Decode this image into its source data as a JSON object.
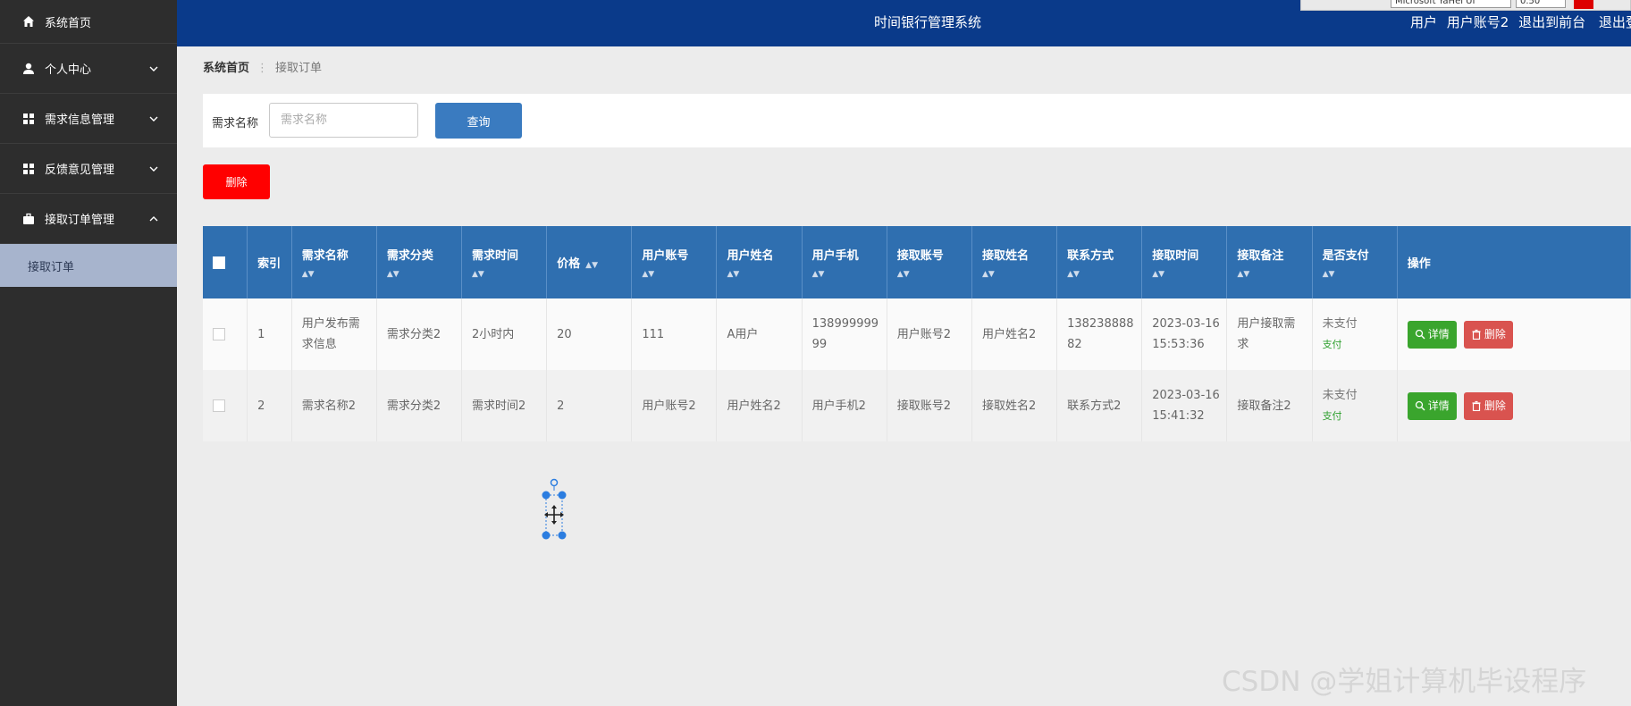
{
  "app": {
    "title": "时间银行管理系统"
  },
  "header": {
    "user_links": [
      "用户",
      "用户账号2",
      "退出到前台",
      "退出登"
    ],
    "toolbar_font": "Microsoft YaHei UI",
    "toolbar_size": "0.50"
  },
  "sidebar": {
    "items": [
      {
        "label": "系统首页",
        "icon": "home-icon"
      },
      {
        "label": "个人中心",
        "icon": "user-icon",
        "expandable": true
      },
      {
        "label": "需求信息管理",
        "icon": "grid-icon",
        "expandable": true
      },
      {
        "label": "反馈意见管理",
        "icon": "grid-icon",
        "expandable": true
      },
      {
        "label": "接取订单管理",
        "icon": "briefcase-icon",
        "expanded": true
      }
    ],
    "sub_item": "接取订单"
  },
  "breadcrumb": {
    "home": "系统首页",
    "current": "接取订单"
  },
  "search": {
    "label": "需求名称",
    "placeholder": "需求名称",
    "button": "查询"
  },
  "toolbar": {
    "delete_label": "删除"
  },
  "table": {
    "headers": [
      "索引",
      "需求名称",
      "需求分类",
      "需求时间",
      "价格",
      "用户账号",
      "用户姓名",
      "用户手机",
      "接取账号",
      "接取姓名",
      "联系方式",
      "接取时间",
      "接取备注",
      "是否支付",
      "操作"
    ],
    "rows": [
      {
        "index": "1",
        "demand_name": "用户发布需求信息",
        "category": "需求分类2",
        "demand_time": "2小时内",
        "price": "20",
        "user_account": "111",
        "user_name": "A用户",
        "user_phone": "13899999999",
        "taker_account": "用户账号2",
        "taker_name": "用户姓名2",
        "contact": "13823888882",
        "take_time": "2023-03-16 15:53:36",
        "take_note": "用户接取需求",
        "paid_status": "未支付",
        "pay_link": "支付"
      },
      {
        "index": "2",
        "demand_name": "需求名称2",
        "category": "需求分类2",
        "demand_time": "需求时间2",
        "price": "2",
        "user_account": "用户账号2",
        "user_name": "用户姓名2",
        "user_phone": "用户手机2",
        "taker_account": "接取账号2",
        "taker_name": "接取姓名2",
        "contact": "联系方式2",
        "take_time": "2023-03-16 15:41:32",
        "take_note": "接取备注2",
        "paid_status": "未支付",
        "pay_link": "支付"
      }
    ],
    "actions": {
      "detail": "详情",
      "delete": "删除"
    }
  },
  "watermark": "CSDN @学姐计算机毕设程序",
  "colors": {
    "header": "#0a3a8a",
    "sidebar": "#2d2d2d",
    "table_header": "#2f6fb0",
    "danger": "#ff0000",
    "success": "#3aa52d"
  }
}
